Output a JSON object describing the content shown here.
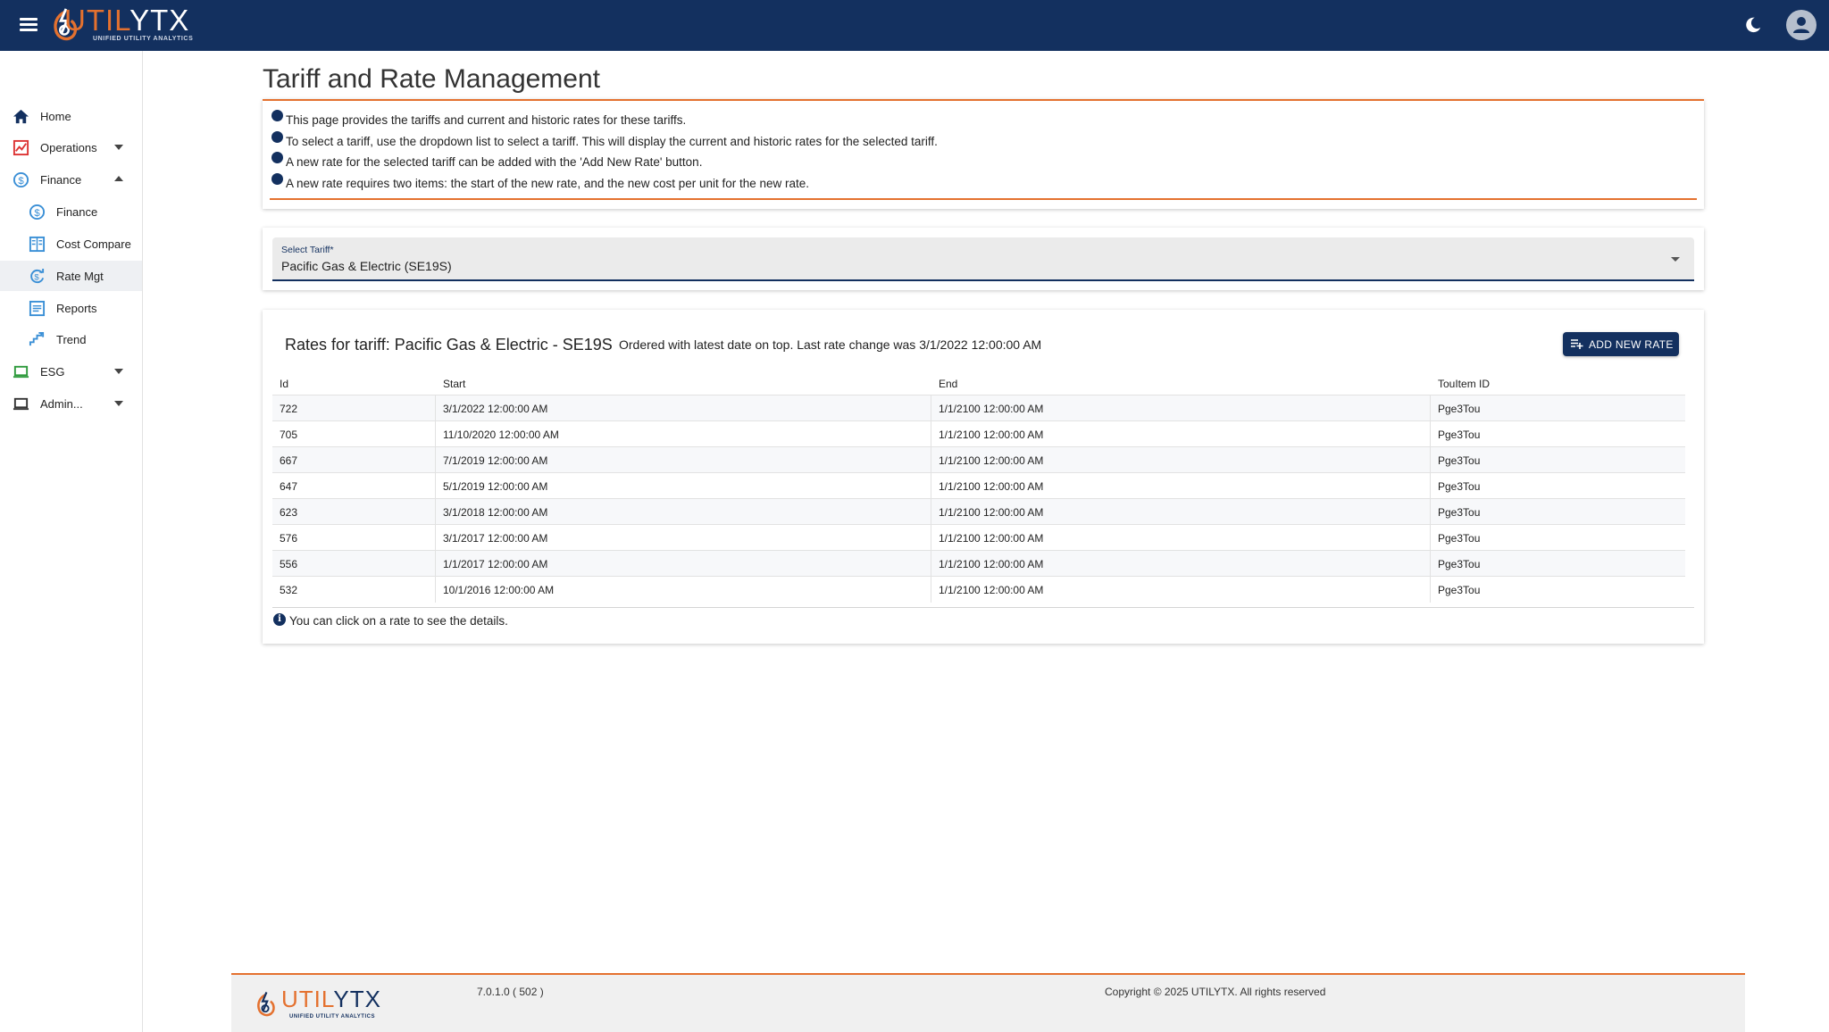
{
  "app": {
    "logo_part1": "UTIL",
    "logo_part2": "YTX",
    "logo_tagline": "UNIFIED UTILITY ANALYTICS",
    "accent_color": "#e4712f",
    "brand_color": "#13305f"
  },
  "topbar": {
    "menu_icon": "hamburger-menu-icon",
    "theme_icon": "moon-icon",
    "account_icon": "user-avatar-icon"
  },
  "sidebar": {
    "items": [
      {
        "label": "Home",
        "icon": "home-icon"
      },
      {
        "label": "Operations",
        "icon": "chart-line-icon",
        "expandable": true,
        "expanded": false
      },
      {
        "label": "Finance",
        "icon": "dollar-circle-icon",
        "expandable": true,
        "expanded": true
      },
      {
        "label": "Finance",
        "icon": "dollar-circle-icon",
        "sub": true
      },
      {
        "label": "Cost Compare",
        "icon": "compare-book-icon",
        "sub": true
      },
      {
        "label": "Rate Mgt",
        "icon": "dollar-refresh-icon",
        "sub": true,
        "active": true
      },
      {
        "label": "Reports",
        "icon": "list-document-icon",
        "sub": true
      },
      {
        "label": "Trend",
        "icon": "trend-steps-icon",
        "sub": true
      },
      {
        "label": "ESG",
        "icon": "laptop-icon",
        "expandable": true,
        "expanded": false
      },
      {
        "label": "Admin...",
        "icon": "laptop-icon",
        "expandable": true,
        "expanded": false
      }
    ]
  },
  "page": {
    "title": "Tariff and Rate Management",
    "info_lines": [
      "This page provides the tariffs and current and historic rates for these tariffs.",
      "To select a tariff, use the dropdown list to select a tariff. This will display the current and historic rates for the selected tariff.",
      "A new rate for the selected tariff can be added with the 'Add New Rate' button.",
      "A new rate requires two items: the start of the new rate, and the new cost per unit for the new rate."
    ]
  },
  "tariff_select": {
    "label": "Select Tariff*",
    "value": "Pacific Gas & Electric (SE19S)"
  },
  "rates": {
    "title": "Rates for tariff: Pacific Gas & Electric - SE19S",
    "subtitle": "Ordered with latest date on top. Last rate change was 3/1/2022 12:00:00 AM",
    "add_button": "ADD NEW RATE",
    "columns": [
      "Id",
      "Start",
      "End",
      "TouItem ID"
    ],
    "rows": [
      [
        "722",
        "3/1/2022 12:00:00 AM",
        "1/1/2100 12:00:00 AM",
        "Pge3Tou"
      ],
      [
        "705",
        "11/10/2020 12:00:00 AM",
        "1/1/2100 12:00:00 AM",
        "Pge3Tou"
      ],
      [
        "667",
        "7/1/2019 12:00:00 AM",
        "1/1/2100 12:00:00 AM",
        "Pge3Tou"
      ],
      [
        "647",
        "5/1/2019 12:00:00 AM",
        "1/1/2100 12:00:00 AM",
        "Pge3Tou"
      ],
      [
        "623",
        "3/1/2018 12:00:00 AM",
        "1/1/2100 12:00:00 AM",
        "Pge3Tou"
      ],
      [
        "576",
        "3/1/2017 12:00:00 AM",
        "1/1/2100 12:00:00 AM",
        "Pge3Tou"
      ],
      [
        "556",
        "1/1/2017 12:00:00 AM",
        "1/1/2100 12:00:00 AM",
        "Pge3Tou"
      ],
      [
        "532",
        "10/1/2016 12:00:00 AM",
        "1/1/2100 12:00:00 AM",
        "Pge3Tou"
      ]
    ],
    "hint": "You can click on a rate to see the details."
  },
  "footer": {
    "version": "7.0.1.0 ( 502 )",
    "copyright": "Copyright © 2025 UTILYTX. All rights reserved"
  }
}
